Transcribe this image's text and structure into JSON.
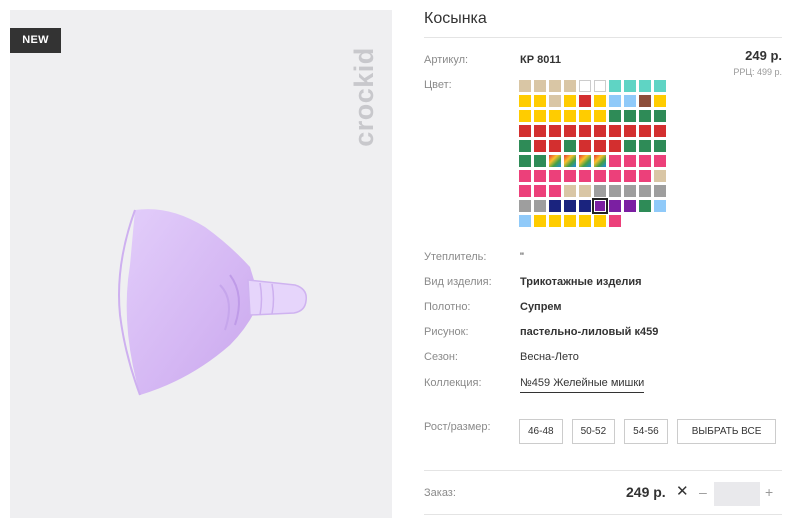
{
  "badge": "NEW",
  "brand": "crockid",
  "title": "Косынка",
  "article": {
    "label": "Артикул:",
    "value": "КР 8011"
  },
  "price": "249 р.",
  "rrp": "РРЦ: 499 р.",
  "color_label": "Цвет:",
  "swatches": [
    "#d9c6a5",
    "#d9c6a5",
    "#d9c6a5",
    "#d9c6a5",
    "#ffffff",
    "#ffffff",
    "#5fd4c4",
    "#5fd4c4",
    "#5fd4c4",
    "#5fd4c4",
    "#ffcc00",
    "#ffcc00",
    "#d9c6a5",
    "#ffcc00",
    "#d32f2f",
    "#ffcc00",
    "#90caf9",
    "#90caf9",
    "#8d4e3a",
    "#ffcc00",
    "#ffcc00",
    "#ffcc00",
    "#ffcc00",
    "#ffcc00",
    "#ffcc00",
    "#ffcc00",
    "#2e8b57",
    "#2e8b57",
    "#2e8b57",
    "#2e8b57",
    "#d32f2f",
    "#d32f2f",
    "#d32f2f",
    "#d32f2f",
    "#d32f2f",
    "#d32f2f",
    "#d32f2f",
    "#d32f2f",
    "#d32f2f",
    "#d32f2f",
    "#2e8b57",
    "#d32f2f",
    "#d32f2f",
    "#2e8b57",
    "#d32f2f",
    "#d32f2f",
    "#d32f2f",
    "#2e8b57",
    "#2e8b57",
    "#2e8b57",
    "#2e8b57",
    "#2e8b57",
    "#rainbow",
    "#rainbow",
    "#rainbow",
    "#rainbow",
    "#ec407a",
    "#ec407a",
    "#ec407a",
    "#ec407a",
    "#ec407a",
    "#ec407a",
    "#ec407a",
    "#ec407a",
    "#ec407a",
    "#ec407a",
    "#ec407a",
    "#ec407a",
    "#ec407a",
    "#d9c6a5",
    "#ec407a",
    "#ec407a",
    "#ec407a",
    "#d9c6a5",
    "#d9c6a5",
    "#9e9e9e",
    "#9e9e9e",
    "#9e9e9e",
    "#9e9e9e",
    "#9e9e9e",
    "#9e9e9e",
    "#9e9e9e",
    "#1a237e",
    "#1a237e",
    "#1a237e",
    "#7b1fa2",
    "#7b1fa2",
    "#7b1fa2",
    "#2e8b57",
    "#90caf9",
    "#90caf9",
    "#ffcc00",
    "#ffcc00",
    "#ffcc00",
    "#ffcc00",
    "#ffcc00",
    "#ec407a"
  ],
  "selected_swatch": 85,
  "props": [
    {
      "label": "Утеплитель:",
      "value": "\"",
      "style": "plain"
    },
    {
      "label": "Вид изделия:",
      "value": "Трикотажные изделия",
      "style": "bold"
    },
    {
      "label": "Полотно:",
      "value": "Супрем",
      "style": "bold"
    },
    {
      "label": "Рисунок:",
      "value": "пастельно-лиловый к459",
      "style": "bold"
    },
    {
      "label": "Сезон:",
      "value": "Весна-Лето",
      "style": "plain"
    },
    {
      "label": "Коллекция:",
      "value": "№459 Желейные мишки",
      "style": "link"
    }
  ],
  "size_label": "Рост/размер:",
  "sizes": [
    "46-48",
    "50-52",
    "54-56"
  ],
  "select_all": "ВЫБРАТЬ ВСЕ",
  "order": {
    "label": "Заказ:",
    "price": "249 р.",
    "x": "✕",
    "minus": "–",
    "plus": "+",
    "qty": ""
  }
}
